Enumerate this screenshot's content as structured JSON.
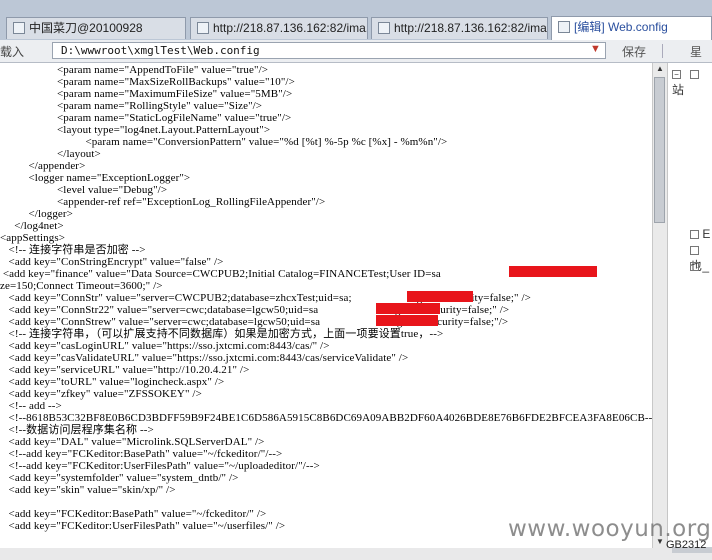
{
  "tabs": [
    {
      "label": "中国菜刀@20100928"
    },
    {
      "label": "http://218.87.136.162:82/ima..."
    },
    {
      "label": "http://218.87.136.162:82/ima..."
    },
    {
      "label": "[编辑] Web.config"
    }
  ],
  "toolbar": {
    "load_label": "载入",
    "path": "D:\\wwwroot\\xmglTest\\Web.config",
    "save_label": "保存",
    "week_label": "星期"
  },
  "editor": {
    "lines": [
      "                    <param name=\"AppendToFile\" value=\"true\"/>",
      "                    <param name=\"MaxSizeRollBackups\" value=\"10\"/>",
      "                    <param name=\"MaximumFileSize\" value=\"5MB\"/>",
      "                    <param name=\"RollingStyle\" value=\"Size\"/>",
      "                    <param name=\"StaticLogFileName\" value=\"true\"/>",
      "                    <layout type=\"log4net.Layout.PatternLayout\">",
      "                              <param name=\"ConversionPattern\" value=\"%d [%t] %-5p %c [%x] - %m%n\"/>",
      "                    </layout>",
      "          </appender>",
      "          <logger name=\"ExceptionLogger\">",
      "                    <level value=\"Debug\"/>",
      "                    <appender-ref ref=\"ExceptionLog_RollingFileAppender\"/>",
      "          </logger>",
      "     </log4net>",
      "<appSettings>",
      "   <!-- 连接字符串是否加密 -->",
      "   <add key=\"ConStringEncrypt\" value=\"false\" />",
      " <add key=\"finance\" value=\"Data Source=CWCPUB2;Initial Catalog=FINANCETest;User ID=sa                              Max Pool",
      "ze=150;Connect Timeout=3600;\" />",
      "   <add key=\"ConnStr\" value=\"server=CWCPUB2;database=zhcxTest;uid=sa;                    tegrated security=false;\" />",
      "   <add key=\"ConnStr22\" value=\"server=cwc;database=lgcw50;uid=sa                     integrated security=false;\" />",
      "   <add key=\"ConnStrew\" value=\"server=cwc;database=lgcw50;uid=sa                     integrated security=false;\"/>",
      "   <!-- 连接字符串，（可以扩展支持不同数据库）如果是加密方式，上面一项要设置true，-->",
      "   <add key=\"casLoginURL\" value=\"https://sso.jxtcmi.com:8443/cas/\" />",
      "   <add key=\"casValidateURL\" value=\"https://sso.jxtcmi.com:8443/cas/serviceValidate\" />",
      "   <add key=\"serviceURL\" value=\"http://10.20.4.21\" />",
      "   <add key=\"toURL\" value=\"logincheck.aspx\" />",
      "   <add key=\"zfkey\" value=\"ZFSSOKEY\" />",
      "   <!-- add -->",
      "   <!--8618B53C32BF8E0B6CD3BDFF59B9F24BE1C6D586A5915C8B6DC69A09ABB2DF60A4026BDE8E76B6FDE2BFCEA3FA8E06CB-->",
      "   <!--数据访问层程序集名称 -->",
      "   <add key=\"DAL\" value=\"Microlink.SQLServerDAL\" />",
      "   <!--add key=\"FCKeditor:BasePath\" value=\"~/fckeditor/\"/-->",
      "   <!--add key=\"FCKeditor:UserFilesPath\" value=\"~/uploadeditor/\"/-->",
      "   <add key=\"systemfolder\" value=\"system_dntb/\" />",
      "   <add key=\"skin\" value=\"skin/xp/\" />",
      "",
      "   <add key=\"FCKeditor:BasePath\" value=\"~/fckeditor/\" />",
      "   <add key=\"FCKeditor:UserFilesPath\" value=\"~/userfiles/\" />"
    ]
  },
  "panel": {
    "items": [
      {
        "label": "站"
      },
      {
        "label": "E"
      },
      {
        "label": "也"
      },
      {
        "label": "_"
      }
    ]
  },
  "watermark": "www.wooyun.org",
  "status": "GB2312"
}
